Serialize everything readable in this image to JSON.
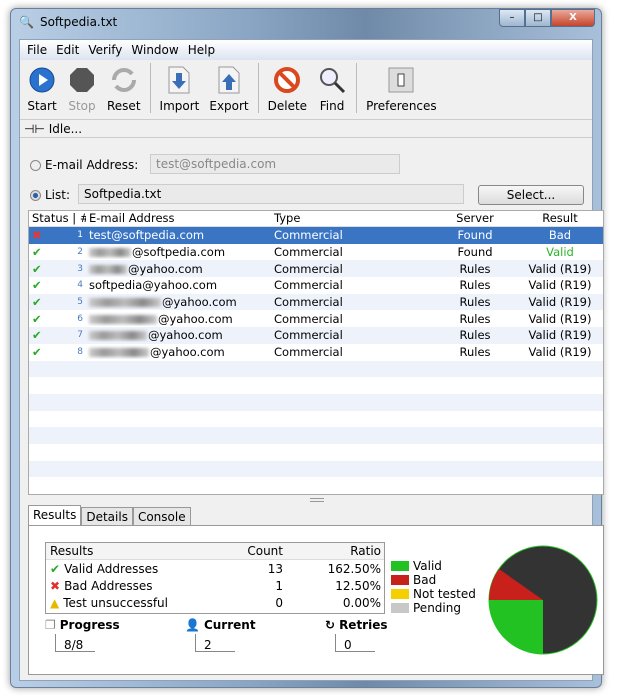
{
  "window": {
    "title": "Softpedia.txt",
    "minimize": "–",
    "maximize": "□",
    "close": "X"
  },
  "menu": [
    "File",
    "Edit",
    "Verify",
    "Window",
    "Help"
  ],
  "toolbar": [
    {
      "label": "Start",
      "icon": "play-icon",
      "enabled": true
    },
    {
      "label": "Stop",
      "icon": "stop-icon",
      "enabled": false
    },
    {
      "label": "Reset",
      "icon": "reset-icon",
      "enabled": true
    },
    {
      "label": "Import",
      "icon": "import-icon",
      "enabled": true
    },
    {
      "label": "Export",
      "icon": "export-icon",
      "enabled": true
    },
    {
      "label": "Delete",
      "icon": "delete-icon",
      "enabled": true
    },
    {
      "label": "Find",
      "icon": "find-icon",
      "enabled": true
    },
    {
      "label": "Preferences",
      "icon": "preferences-icon",
      "enabled": true
    }
  ],
  "status": "Idle...",
  "source": {
    "email_label": "E-mail Address:",
    "email_value": "test@softpedia.com",
    "list_label": "List:",
    "list_value": "Softpedia.txt",
    "select_button": "Select...",
    "selected": "list"
  },
  "grid": {
    "headers": [
      "Status | #",
      "E-mail Address",
      "Type",
      "Server",
      "Result"
    ],
    "rows": [
      {
        "status": "bad",
        "num": "1",
        "email": "test@softpedia.com",
        "blurred": false,
        "type": "Commercial",
        "server": "Found",
        "result": "Bad",
        "selected": true
      },
      {
        "status": "valid",
        "num": "2",
        "email": "@softpedia.com",
        "blurred": true,
        "type": "Commercial",
        "server": "Found",
        "result": "Valid"
      },
      {
        "status": "valid",
        "num": "3",
        "email": "@yahoo.com",
        "blurred": true,
        "type": "Commercial",
        "server": "Rules",
        "result": "Valid (R19)"
      },
      {
        "status": "valid",
        "num": "4",
        "email": "softpedia@yahoo.com",
        "blurred": false,
        "type": "Commercial",
        "server": "Rules",
        "result": "Valid (R19)"
      },
      {
        "status": "valid",
        "num": "5",
        "email": "@yahoo.com",
        "blurred": true,
        "type": "Commercial",
        "server": "Rules",
        "result": "Valid (R19)"
      },
      {
        "status": "valid",
        "num": "6",
        "email": "@yahoo.com",
        "blurred": true,
        "type": "Commercial",
        "server": "Rules",
        "result": "Valid (R19)"
      },
      {
        "status": "valid",
        "num": "7",
        "email": "@yahoo.com",
        "blurred": true,
        "type": "Commercial",
        "server": "Rules",
        "result": "Valid (R19)"
      },
      {
        "status": "valid",
        "num": "8",
        "email": "@yahoo.com",
        "blurred": true,
        "type": "Commercial",
        "server": "Rules",
        "result": "Valid (R19)"
      }
    ]
  },
  "tabs": [
    {
      "label": "Results",
      "active": true
    },
    {
      "label": "Details"
    },
    {
      "label": "Console"
    }
  ],
  "results": {
    "headers": [
      "Results",
      "Count",
      "Ratio"
    ],
    "rows": [
      {
        "label": "Valid Addresses",
        "count": "13",
        "ratio": "162.50%",
        "icon": "check-icon"
      },
      {
        "label": "Bad Addresses",
        "count": "1",
        "ratio": "12.50%",
        "icon": "cross-icon"
      },
      {
        "label": "Test unsuccessful",
        "count": "0",
        "ratio": "0.00%",
        "icon": "warning-icon"
      }
    ]
  },
  "legend": [
    {
      "label": "Valid",
      "color": "#22c222"
    },
    {
      "label": "Bad",
      "color": "#c8201a"
    },
    {
      "label": "Not tested",
      "color": "#f5d000"
    },
    {
      "label": "Pending",
      "color": "#c8c8c8"
    }
  ],
  "pie_colors": {
    "valid": "#22c222",
    "bad": "#c8201a",
    "remaining": "#333333"
  },
  "stats": {
    "progress_label": "Progress",
    "progress_value": "8/8",
    "current_label": "Current",
    "current_value": "2",
    "retries_label": "Retries",
    "retries_value": "0"
  }
}
